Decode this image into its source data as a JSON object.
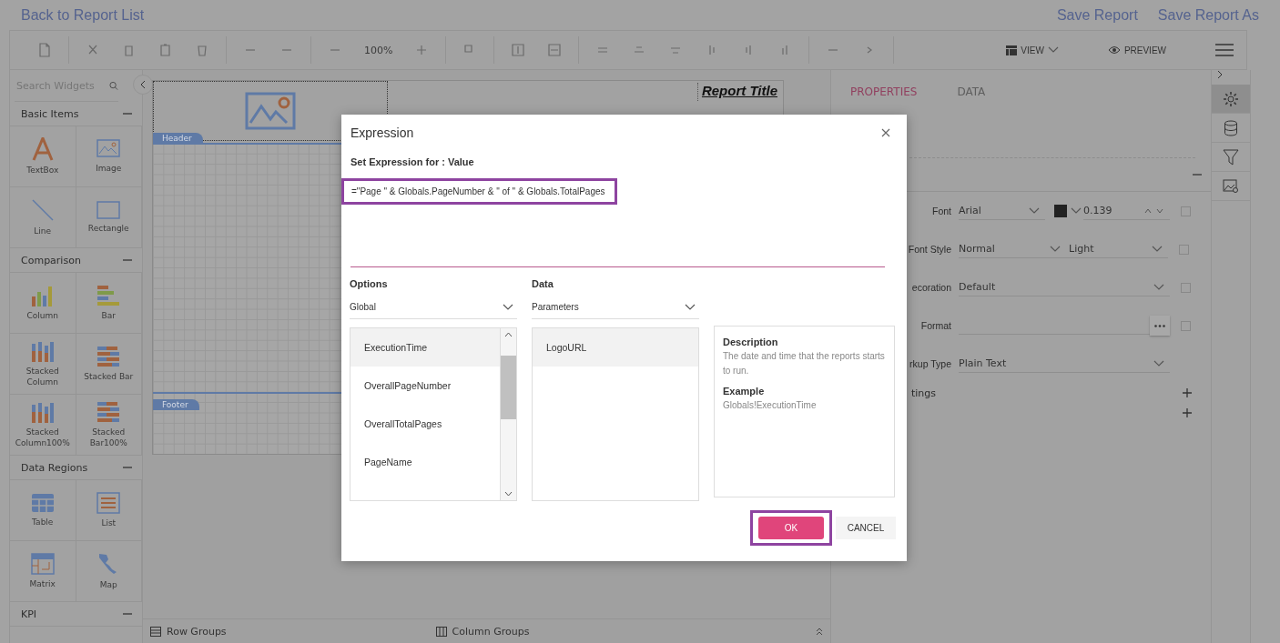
{
  "top_bar": {
    "back_link": "Back to Report List",
    "actions": [
      "Save Report",
      "Save Report As"
    ]
  },
  "toolbar": {
    "zoom": "100%",
    "view": "VIEW",
    "preview": "PREVIEW"
  },
  "sidebar": {
    "search": {
      "placeholder": "Search Widgets"
    },
    "sections": [
      {
        "title": "Basic Items",
        "expanded": true,
        "items": [
          {
            "label": "TextBox",
            "kind": "textbox"
          },
          {
            "label": "Image",
            "kind": "image"
          },
          {
            "label": "Line",
            "kind": "line"
          },
          {
            "label": "Rectangle",
            "kind": "rectangle"
          }
        ]
      },
      {
        "title": "Comparison",
        "expanded": true,
        "items": [
          {
            "label": "Column",
            "kind": "column"
          },
          {
            "label": "Bar",
            "kind": "bar"
          },
          {
            "label": "Stacked Column",
            "kind": "stacked-column"
          },
          {
            "label": "Stacked Bar",
            "kind": "stacked-bar"
          },
          {
            "label": "Stacked Column100%",
            "kind": "stacked-column"
          },
          {
            "label": "Stacked Bar100%",
            "kind": "stacked-bar"
          }
        ]
      },
      {
        "title": "Data Regions",
        "expanded": true,
        "items": [
          {
            "label": "Table",
            "kind": "table"
          },
          {
            "label": "List",
            "kind": "list"
          },
          {
            "label": "Matrix",
            "kind": "matrix"
          },
          {
            "label": "Map",
            "kind": "map"
          }
        ]
      },
      {
        "title": "KPI",
        "expanded": true
      }
    ]
  },
  "report": {
    "title": "Report Title",
    "header_label": "Header",
    "footer_label": "Footer"
  },
  "bottom_bar": {
    "row_groups": "Row Groups",
    "column_groups": "Column Groups"
  },
  "properties": {
    "tabs": [
      {
        "label": "PROPERTIES",
        "selected": true
      },
      {
        "label": "DATA",
        "selected": false
      }
    ],
    "rows": [
      {
        "label": "Font",
        "kind": "font",
        "value": "Arial",
        "color": "#222222",
        "size": "0.139",
        "checked": false
      },
      {
        "label": "Font Style",
        "kind": "double",
        "value": "Normal",
        "value2": "Light",
        "checked": false
      },
      {
        "label": "ecoration",
        "kind": "select",
        "value": "Default",
        "checked": false
      },
      {
        "label": "Format",
        "kind": "button",
        "checked": false
      },
      {
        "label": "rkup Type",
        "kind": "select",
        "value": "Plain Text"
      }
    ],
    "groups": [
      {
        "label": "tings",
        "expanded": false
      },
      {
        "expanded": false
      }
    ]
  },
  "side_strip": [
    {
      "kind": "gear",
      "selected": true
    },
    {
      "kind": "database",
      "selected": false
    },
    {
      "kind": "filter",
      "selected": false
    },
    {
      "kind": "image",
      "selected": false
    }
  ],
  "dialog": {
    "title": "Expression",
    "heading": "Set Expression for : Value",
    "expression": "=\"Page \" & Globals.PageNumber & \" of \" & Globals.TotalPages",
    "options": {
      "label": "Options",
      "value": "Global",
      "items": [
        {
          "label": "ExecutionTime",
          "selected": true
        },
        {
          "label": "OverallPageNumber",
          "selected": false
        },
        {
          "label": "OverallTotalPages",
          "selected": false
        },
        {
          "label": "PageName",
          "selected": false
        }
      ]
    },
    "data": {
      "label": "Data",
      "value": "Parameters",
      "items": [
        {
          "label": "LogoURL",
          "selected": true
        }
      ]
    },
    "description": {
      "heading": "Description",
      "text": "The date and time that the reports starts to run.",
      "example_heading": "Example",
      "example": "Globals!ExecutionTime"
    },
    "buttons": [
      {
        "label": "OK",
        "kind": "primary"
      },
      {
        "label": "CANCEL",
        "kind": "secondary"
      }
    ]
  }
}
